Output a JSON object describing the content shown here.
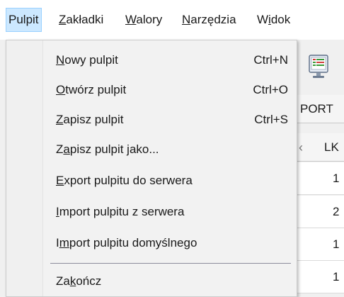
{
  "menubar": {
    "items": [
      {
        "pre": "",
        "key": "",
        "post": "Pulpit",
        "active": true
      },
      {
        "pre": "",
        "key": "Z",
        "post": "akładki",
        "active": false
      },
      {
        "pre": "",
        "key": "W",
        "post": "alory",
        "active": false
      },
      {
        "pre": "",
        "key": "N",
        "post": "arzędzia",
        "active": false
      },
      {
        "pre": "W",
        "key": "i",
        "post": "dok",
        "active": false
      }
    ]
  },
  "dropdown": {
    "items": [
      {
        "pre": "",
        "key": "N",
        "post": "owy pulpit",
        "shortcut": "Ctrl+N"
      },
      {
        "pre": "",
        "key": "O",
        "post": "twórz pulpit",
        "shortcut": "Ctrl+O"
      },
      {
        "pre": "",
        "key": "Z",
        "post": "apisz pulpit",
        "shortcut": "Ctrl+S"
      },
      {
        "pre": "Z",
        "key": "a",
        "post": "pisz pulpit jako...",
        "shortcut": ""
      },
      {
        "pre": "",
        "key": "E",
        "post": "xport pulpitu do serwera",
        "shortcut": ""
      },
      {
        "pre": "",
        "key": "I",
        "post": "mport pulpitu z serwera",
        "shortcut": ""
      },
      {
        "pre": "I",
        "key": "m",
        "post": "port pulpitu domyślnego",
        "shortcut": ""
      },
      {
        "pre": "Za",
        "key": "k",
        "post": "ończ",
        "shortcut": ""
      }
    ]
  },
  "background": {
    "tab_label": "PORT",
    "column_label": "LK",
    "rows": [
      "1",
      "2",
      "1",
      "1"
    ]
  },
  "colors": {
    "menubar_active_bg": "#cce8ff",
    "menubar_active_border": "#99d1ff",
    "dropdown_bg": "#f2f2f2",
    "separator": "#8c8c9c"
  },
  "icons": {
    "toolbar": "monitor-report-icon",
    "column_chevron": "chevron-left-icon"
  }
}
